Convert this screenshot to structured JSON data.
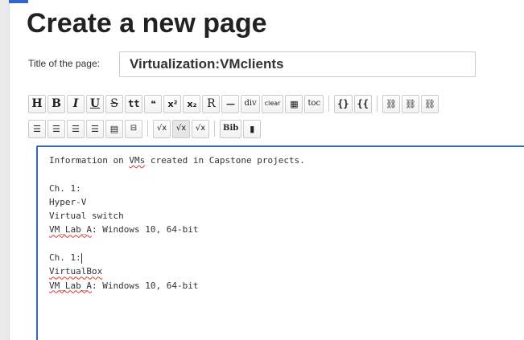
{
  "page": {
    "heading": "Create a new page",
    "title_label": "Title of the page:",
    "title_value": "Virtualization:VMclients"
  },
  "toolbar": {
    "row1": [
      {
        "name": "heading-button",
        "label": "H"
      },
      {
        "name": "bold-button",
        "label": "B"
      },
      {
        "name": "italic-button",
        "label": "I"
      },
      {
        "name": "underline-button",
        "label": "U"
      },
      {
        "name": "strikethrough-button",
        "label": "S"
      },
      {
        "name": "teletype-button",
        "label": "tt"
      },
      {
        "name": "quote-button",
        "label": "❝"
      },
      {
        "name": "superscript-button",
        "label": "x²"
      },
      {
        "name": "subscript-button",
        "label": "x₂"
      },
      {
        "name": "redirect-button",
        "label": "R"
      },
      {
        "name": "horizontal-rule-button",
        "label": "—"
      },
      {
        "name": "div-button",
        "label": "div"
      },
      {
        "name": "clear-button",
        "label": "clear"
      },
      {
        "name": "table-button",
        "label": "▦"
      },
      {
        "name": "toc-button",
        "label": "toc"
      },
      {
        "name": "template-button",
        "label": "{}"
      },
      {
        "name": "template-param-button",
        "label": "{{"
      },
      {
        "name": "internal-link-button",
        "label": "🔗"
      },
      {
        "name": "external-link-button",
        "label": "🔗"
      },
      {
        "name": "link-image-button",
        "label": "🔗"
      }
    ],
    "row2": [
      {
        "name": "numbered-list-button",
        "label": "1≡"
      },
      {
        "name": "bullet-list-button",
        "label": "•≡"
      },
      {
        "name": "indent-button",
        "label": "→≡"
      },
      {
        "name": "outdent-button",
        "label": "←≡"
      },
      {
        "name": "definition-list-button",
        "label": "■≡"
      },
      {
        "name": "reference-button",
        "label": "¹"
      },
      {
        "name": "math-button",
        "label": "√x"
      },
      {
        "name": "math-block-button",
        "label": "√x"
      },
      {
        "name": "math-inline-button",
        "label": "√x"
      },
      {
        "name": "bib-button",
        "label": "Bib"
      },
      {
        "name": "bookmark-button",
        "label": "▮"
      }
    ]
  },
  "editor": {
    "lines": [
      "Information on VMs created in Capstone projects.",
      "",
      "Ch. 1:",
      "Hyper-V",
      "Virtual switch",
      "VM_Lab_A: Windows 10, 64-bit",
      "",
      "Ch. 1:",
      "VirtualBox",
      "VM_Lab_A: Windows 10, 64-bit"
    ]
  }
}
